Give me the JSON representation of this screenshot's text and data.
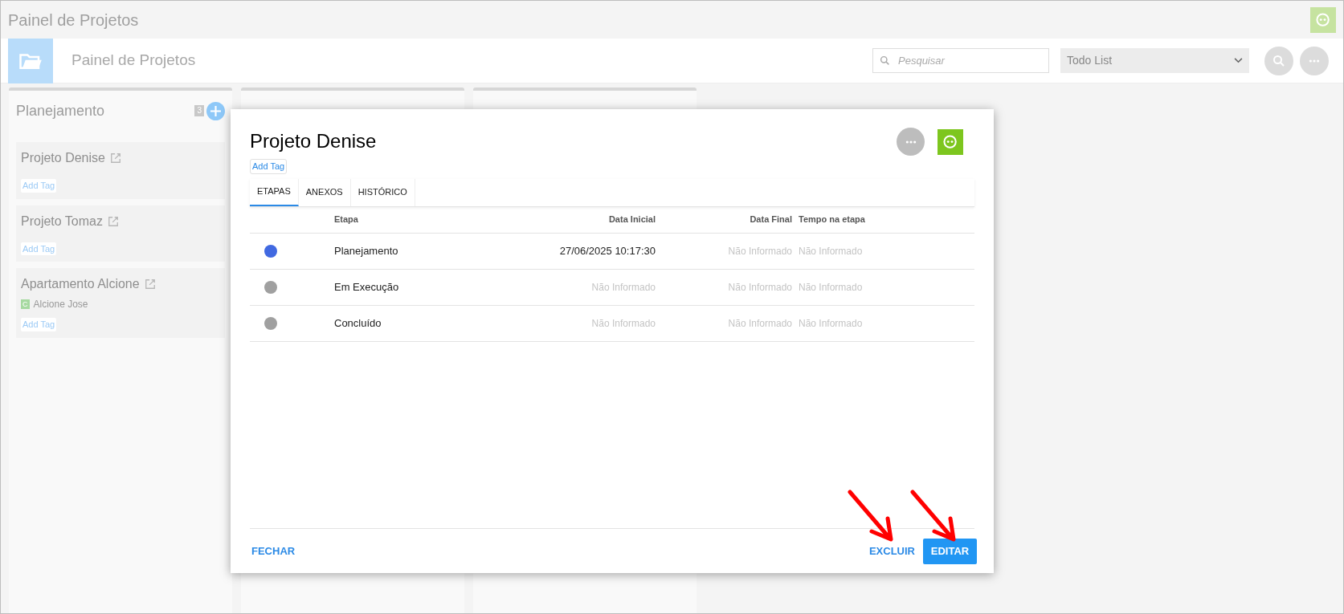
{
  "app_title": "Painel de Projetos",
  "header": {
    "title": "Painel de Projetos",
    "search": {
      "placeholder": "Pesquisar"
    },
    "list_select": {
      "value": "Todo List"
    }
  },
  "columns": [
    {
      "title": "Planejamento",
      "count": "3",
      "cards": [
        {
          "title": "Projeto Denise",
          "add_tag": "Add Tag"
        },
        {
          "title": "Projeto Tomaz",
          "add_tag": "Add Tag"
        },
        {
          "title": "Apartamento Alcione",
          "client_initial": "C",
          "client": "Alcione Jose",
          "add_tag": "Add Tag"
        }
      ]
    },
    {
      "kind": "covered"
    },
    {
      "kind": "covered"
    }
  ],
  "modal": {
    "title": "Projeto Denise",
    "add_tag": "Add Tag",
    "tabs": [
      {
        "label": "ETAPAS",
        "selected": true
      },
      {
        "label": "ANEXOS",
        "selected": false
      },
      {
        "label": "HISTÓRICO",
        "selected": false
      }
    ],
    "table": {
      "columns": [
        "Etapa",
        "Data Inicial",
        "Data Final",
        "Tempo na etapa"
      ],
      "rows": [
        {
          "color": "#4169e1",
          "cells": [
            {
              "text": "Planejamento",
              "muted": false
            },
            {
              "text": "27/06/2025 10:17:30",
              "muted": false
            },
            {
              "text": "Não Informado",
              "muted": true
            },
            {
              "text": "Não Informado",
              "muted": true
            }
          ]
        },
        {
          "color": "#a0a0a0",
          "cells": [
            {
              "text": "Em Execução",
              "muted": false
            },
            {
              "text": "Não Informado",
              "muted": true
            },
            {
              "text": "Não Informado",
              "muted": true
            },
            {
              "text": "Não Informado",
              "muted": true
            }
          ]
        },
        {
          "color": "#a0a0a0",
          "cells": [
            {
              "text": "Concluído",
              "muted": false
            },
            {
              "text": "Não Informado",
              "muted": true
            },
            {
              "text": "Não Informado",
              "muted": true
            },
            {
              "text": "Não Informado",
              "muted": true
            }
          ]
        }
      ]
    },
    "buttons": {
      "close": "FECHAR",
      "delete": "EXCLUIR",
      "edit": "EDITAR"
    }
  }
}
